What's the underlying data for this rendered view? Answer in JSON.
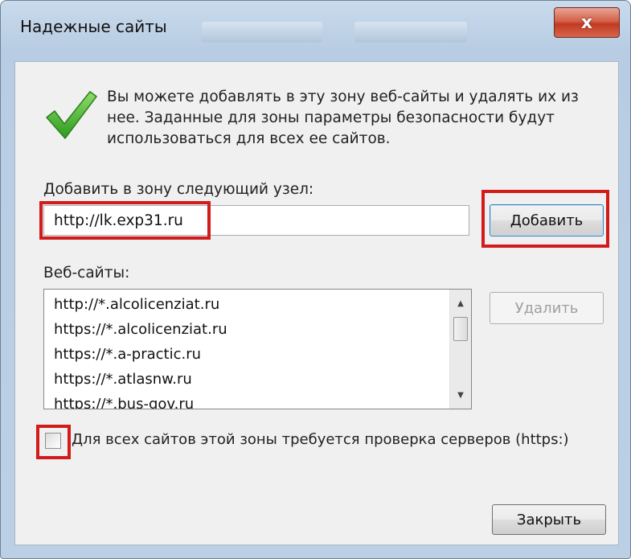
{
  "window": {
    "title": "Надежные сайты",
    "close_symbol": "x"
  },
  "info_text": "Вы можете добавлять в эту зону веб-сайты и удалять их из нее. Заданные для зоны параметры безопасности будут использоваться для всех ее сайтов.",
  "add_site": {
    "label": "Добавить в зону следующий узел:",
    "value": "http://lk.exp31.ru",
    "add_button": "Добавить"
  },
  "websites": {
    "label": "Веб-сайты:",
    "items": [
      "http://*.alcolicenziat.ru",
      "https://*.alcolicenziat.ru",
      "https://*.a-practic.ru",
      "https://*.atlasnw.ru",
      "https://*.bus-gov.ru"
    ],
    "remove_button": "Удалить"
  },
  "require_https": {
    "label": "Для всех сайтов этой зоны требуется проверка серверов (https:)",
    "checked": false
  },
  "close_button": "Закрыть",
  "icons": {
    "success": "checkmark-icon",
    "close": "close-icon",
    "scroll_up": "scroll-up-arrow-icon",
    "scroll_down": "scroll-down-arrow-icon"
  },
  "colors": {
    "highlight": "#d21c1c",
    "check_green": "#3fae2a",
    "close_red": "#c23a22"
  }
}
